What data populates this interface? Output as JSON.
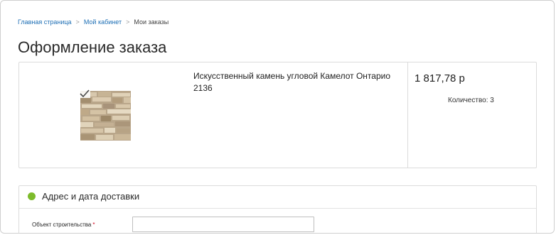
{
  "breadcrumb": {
    "items": [
      "Главная страница",
      "Мой кабинет",
      "Мои заказы"
    ],
    "separator": ">"
  },
  "page": {
    "title": "Оформление заказа"
  },
  "order": {
    "product": {
      "name": "Искусственный камень угловой Камелот Онтарио 2136",
      "image_icon": "stone-product-image",
      "badge_icon": "check-icon"
    },
    "price": "1 817,78 р",
    "quantity_label": "Количество: 3"
  },
  "delivery": {
    "status_color": "#7dbb2b",
    "section_title": "Адрес и дата доставки",
    "fields": [
      {
        "label": "Объект строительства",
        "required_mark": "*",
        "value": "",
        "placeholder": ""
      }
    ]
  },
  "colors": {
    "link": "#1e6fb5",
    "required": "#d0021b",
    "border": "#dcdcdc"
  }
}
